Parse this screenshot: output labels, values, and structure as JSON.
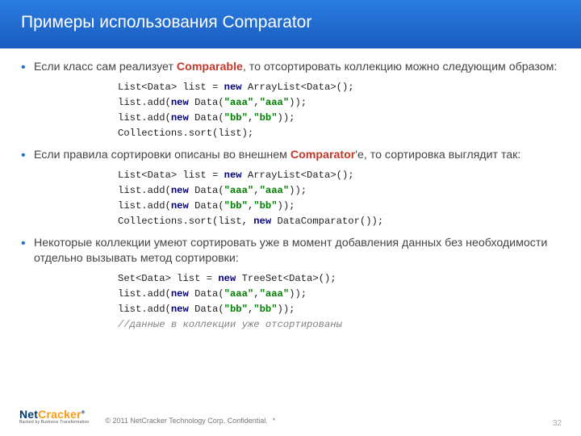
{
  "title": "Примеры использования Comparator",
  "bullets": {
    "b1a": "Если класс сам реализует ",
    "b1hl": "Comparable",
    "b1b": ", то отсортировать коллекцию можно следующим образом:",
    "b2a": "Если правила сортировки описаны во внешнем ",
    "b2hl": "Comparator",
    "b2b": "'е, то сортировка выглядит так:",
    "b3": "Некоторые коллекции умеют сортировать уже в момент добавления данных без необходимости отдельно вызывать метод сортировки:"
  },
  "code1": {
    "l1a": "List<Data> list = ",
    "l1kw": "new",
    "l1b": " ArrayList<Data>();",
    "l2a": "list.add(",
    "l2kw": "new",
    "l2b": " Data(",
    "l2s1": "\"aaa\"",
    "l2c": ",",
    "l2s2": "\"aaa\"",
    "l2d": "));",
    "l3a": "list.add(",
    "l3kw": "new",
    "l3b": " Data(",
    "l3s1": "\"bb\"",
    "l3c": ",",
    "l3s2": "\"bb\"",
    "l3d": "));",
    "l4": "Collections.sort(list);"
  },
  "code2": {
    "l1a": "List<Data> list = ",
    "l1kw": "new",
    "l1b": " ArrayList<Data>();",
    "l2a": "list.add(",
    "l2kw": "new",
    "l2b": " Data(",
    "l2s1": "\"aaa\"",
    "l2c": ",",
    "l2s2": "\"aaa\"",
    "l2d": "));",
    "l3a": "list.add(",
    "l3kw": "new",
    "l3b": " Data(",
    "l3s1": "\"bb\"",
    "l3c": ",",
    "l3s2": "\"bb\"",
    "l3d": "));",
    "l4a": "Collections.sort(list, ",
    "l4kw": "new",
    "l4b": " DataComparator());"
  },
  "code3": {
    "l1a": "Set<Data> list = ",
    "l1kw": "new",
    "l1b": " TreeSet<Data>();",
    "l2a": "list.add(",
    "l2kw": "new",
    "l2b": " Data(",
    "l2s1": "\"aaa\"",
    "l2c": ",",
    "l2s2": "\"aaa\"",
    "l2d": "));",
    "l3a": "list.add(",
    "l3kw": "new",
    "l3b": " Data(",
    "l3s1": "\"bb\"",
    "l3c": ",",
    "l3s2": "\"bb\"",
    "l3d": "));",
    "l4cmt": "//данные в коллекции уже отсортированы"
  },
  "footer": {
    "logo1": "Net",
    "logo2": "Cracker",
    "tagline": "Backed by Business Transformation",
    "copy": "© 2011 NetCracker Technology Corp. Confidential.",
    "star": "*",
    "page": "32"
  }
}
